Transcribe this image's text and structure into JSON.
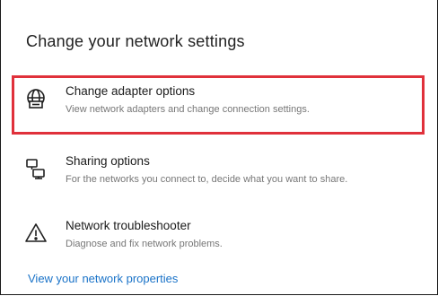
{
  "page": {
    "title": "Change your network settings"
  },
  "options": [
    {
      "title": "Change adapter options",
      "description": "View network adapters and change connection settings.",
      "icon": "adapter-icon"
    },
    {
      "title": "Sharing options",
      "description": "For the networks you connect to, decide what you want to share.",
      "icon": "sharing-icon"
    },
    {
      "title": "Network troubleshooter",
      "description": "Diagnose and fix network problems.",
      "icon": "warning-icon"
    }
  ],
  "links": {
    "network_properties": "View your network properties"
  },
  "colors": {
    "highlight": "#e0313b",
    "link": "#1a73c8"
  }
}
